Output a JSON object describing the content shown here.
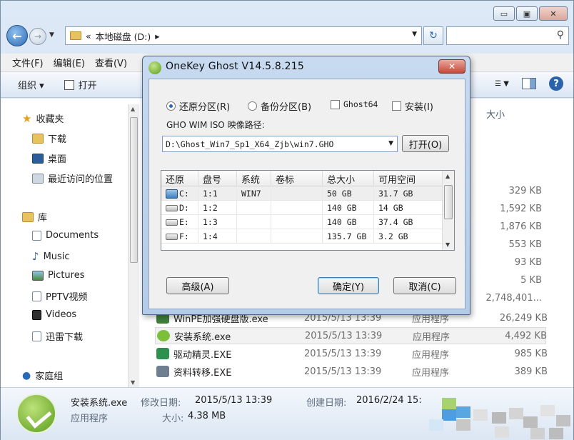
{
  "explorer": {
    "window_buttons": {
      "minimize": "▭",
      "maximize": "▣",
      "close": "✕"
    },
    "address": {
      "prefix": "«",
      "path": "本地磁盘 (D:)",
      "sep": "▸"
    },
    "menu": [
      "文件(F)",
      "编辑(E)",
      "查看(V)"
    ],
    "toolbar": {
      "organize": "组织 ▾",
      "open": "打开"
    },
    "nav": {
      "favorites": "收藏夹",
      "downloads": "下载",
      "desktop": "桌面",
      "recent": "最近访问的位置",
      "library": "库",
      "documents": "Documents",
      "music": "Music",
      "pictures": "Pictures",
      "pptv": "PPTV视频",
      "videos": "Videos",
      "xunlei": "迅雷下载",
      "homegroup": "家庭组"
    },
    "size_header": "大小",
    "sizes_behind_dialog": [
      "329 KB",
      "1,592 KB",
      "1,876 KB",
      "553 KB",
      "93 KB",
      "5 KB",
      "2,748,401..."
    ],
    "files": [
      {
        "name": "WinPE加强硬盘版.exe",
        "date": "2015/5/13 13:39",
        "type": "应用程序",
        "size": "26,249 KB",
        "color": "#3f7f3a"
      },
      {
        "name": "安装系统.exe",
        "date": "2015/5/13 13:39",
        "type": "应用程序",
        "size": "4,492 KB",
        "color": "#7cc03a"
      },
      {
        "name": "驱动精灵.EXE",
        "date": "2015/5/13 13:39",
        "type": "应用程序",
        "size": "985 KB",
        "color": "#2f8f4f"
      },
      {
        "name": "资料转移.EXE",
        "date": "2015/5/13 13:39",
        "type": "应用程序",
        "size": "389 KB",
        "color": "#6f7f8f"
      }
    ],
    "status": {
      "name": "安装系统.exe",
      "modified_label": "修改日期:",
      "modified": "2015/5/13 13:39",
      "type": "应用程序",
      "size_label": "大小:",
      "size": "4.38 MB",
      "created_label": "创建日期:",
      "created": "2016/2/24 15:"
    }
  },
  "dialog": {
    "title": "OneKey Ghost V14.5.8.215",
    "close": "✕",
    "options": {
      "restore": "还原分区(R)",
      "backup": "备份分区(B)",
      "ghost64": "Ghost64",
      "install": "安装(I)"
    },
    "path_label": "GHO WIM ISO 映像路径:",
    "path_value": "D:\\Ghost_Win7_Sp1_X64_Zjb\\win7.GHO",
    "open_button": "打开(O)",
    "table": {
      "columns": [
        "还原",
        "盘号",
        "系统",
        "卷标",
        "总大小",
        "可用空间"
      ],
      "rows": [
        [
          "C:",
          "1:1",
          "WIN7",
          "",
          "50 GB",
          "31.7 GB"
        ],
        [
          "D:",
          "1:2",
          "",
          "",
          "140 GB",
          "14 GB"
        ],
        [
          "E:",
          "1:3",
          "",
          "",
          "140 GB",
          "37.4 GB"
        ],
        [
          "F:",
          "1:4",
          "",
          "",
          "135.7 GB",
          "3.2 GB"
        ]
      ]
    },
    "advanced_button": "高级(A)",
    "ok_button": "确定(Y)",
    "cancel_button": "取消(C)"
  }
}
